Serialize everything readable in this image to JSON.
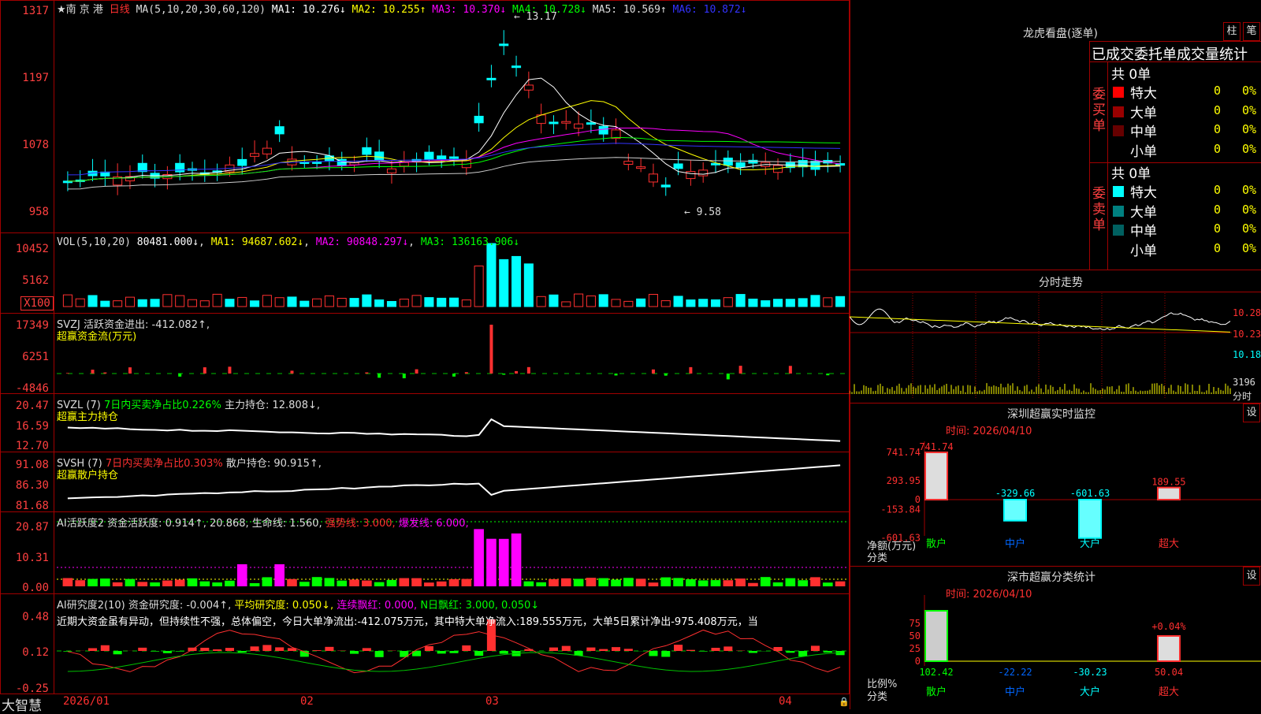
{
  "window": {
    "stock_name": "★南 京 港",
    "period": "日线",
    "watermark": "大智慧"
  },
  "main_chart": {
    "ma_label": "MA(5,10,20,30,60,120)",
    "ma1": "MA1: 10.276↓",
    "ma2": "MA2: 10.255↑",
    "ma3": "MA3: 10.370↓",
    "ma4": "MA4: 10.728↓",
    "ma5": "MA5: 10.569↑",
    "ma6": "MA6: 10.872↓",
    "high_mark": "13.17",
    "low_mark": "9.58",
    "y_ticks": [
      "1317",
      "1197",
      "1078",
      "958"
    ]
  },
  "vol_chart": {
    "label": "VOL(5,10,20)",
    "value": "80481.000↓",
    "ma1": "MA1: 94687.602↓",
    "ma2": "MA2: 90848.297↓",
    "ma3": "MA3: 136163.906↓",
    "y_ticks": [
      "10452",
      "5162",
      "X100"
    ]
  },
  "svzj": {
    "label": "SVZJ  活跃资金进出: -412.082↑,",
    "sub": "超赢资金流(万元)",
    "y_ticks": [
      "17349",
      "6251",
      "-4846"
    ]
  },
  "svzl": {
    "label": "SVZL (7)",
    "pct": "7日内买卖净占比0.226%",
    "hold": "主力持仓: 12.808↓,",
    "sub": "超赢主力持仓",
    "y_ticks": [
      "20.47",
      "16.59",
      "12.70"
    ]
  },
  "svsh": {
    "label": "SVSH (7)",
    "pct": "7日内买卖净占比0.303%",
    "hold": "散户持仓: 90.915↑,",
    "sub": "超赢散户持仓",
    "y_ticks": [
      "91.08",
      "86.30",
      "81.68"
    ]
  },
  "ai_active": {
    "label": "AI活跃度2 资金活跃度: 0.914↑, 20.868, 生命线: 1.560,",
    "strong": "强势线: 3.000,",
    "burst": "爆发线: 6.000,",
    "y_ticks": [
      "20.87",
      "10.31",
      "0.00"
    ]
  },
  "ai_research": {
    "label": "AI研究度2(10) 资金研究度: -0.004↑,",
    "avg": "平均研究度: 0.050↓,",
    "lianxu": "连续飘红: 0.000,",
    "nri": "N日飘红: 3.000, 0.050↓",
    "summary": "近期大资金虽有异动，但持续性不强，总体偏空，今日大单净流出:-412.075万元，其中特大单净流入:189.555万元，大单5日累计净出-975.408万元，当",
    "y_ticks": [
      "0.48",
      "0.12",
      "-0.25"
    ]
  },
  "x_axis": [
    "2026/01",
    "02",
    "03",
    "04"
  ],
  "right_panel": {
    "dragon_title": "龙虎看盘(逐单)",
    "btn_zhu": "柱",
    "btn_bi": "笔",
    "stats_title": "已成交委托单成交量统计",
    "buy_total": "共 0单",
    "sell_total": "共 0单",
    "buy_side": "委买单",
    "sell_side": "委卖单",
    "rows": [
      {
        "name": "特大",
        "count": "0",
        "pct": "0%"
      },
      {
        "name": "大单",
        "count": "0",
        "pct": "0%"
      },
      {
        "name": "中单",
        "count": "0",
        "pct": "0%"
      },
      {
        "name": "小单",
        "count": "0",
        "pct": "0%"
      }
    ],
    "intraday_title": "分时走势",
    "intraday_ticks": [
      "10.28",
      "10.23",
      "10.18"
    ],
    "intraday_vol": "3196",
    "intraday_unit": "分时",
    "monitor_title": "深圳超赢实时监控",
    "monitor_settings": "设",
    "monitor_time": "时间: 2026/04/10",
    "monitor_yticks": [
      "741.74",
      "293.95",
      "0",
      "-153.84",
      "-601.63"
    ],
    "monitor_ylabel": "净额(万元)",
    "monitor_xlabel": "分类",
    "monitor_values": [
      "741.74",
      "-329.66",
      "-601.63",
      "189.55"
    ],
    "categories": [
      "散户",
      "中户",
      "大户",
      "超大"
    ],
    "class_title": "深市超赢分类统计",
    "class_settings": "设",
    "class_time": "时间: 2026/04/10",
    "class_yticks": [
      "75",
      "50",
      "25",
      "0"
    ],
    "class_ylabel": "比例%",
    "class_xlabel": "分类",
    "class_values": [
      "102.42",
      "-22.22",
      "-30.23",
      "50.04"
    ],
    "class_extra": "+0.04%"
  },
  "colors": {
    "up": "#ff3030",
    "down": "#00ffff",
    "grid": "#a00000",
    "ma1": "#ffffff",
    "ma2": "#ffff00",
    "ma3": "#ff00ff",
    "ma4": "#00ff00",
    "ma5": "#cccccc",
    "ma6": "#3333ff"
  }
}
